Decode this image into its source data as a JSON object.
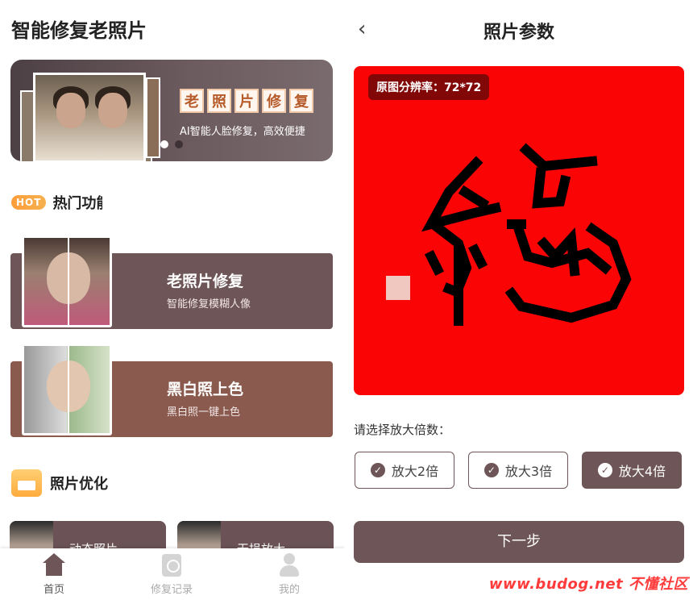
{
  "left": {
    "app_title": "智能修复老照片",
    "banner": {
      "stamp_chars": [
        "老",
        "照",
        "片",
        "修",
        "复"
      ],
      "tagline": "AI智能人脸修复，高效便捷"
    },
    "hot": {
      "badge": "HOT",
      "title": "热门功能"
    },
    "features": [
      {
        "title": "老照片修复",
        "subtitle": "智能修复模糊人像"
      },
      {
        "title": "黑白照上色",
        "subtitle": "黑白照一键上色"
      }
    ],
    "photo_opt": {
      "title": "照片优化",
      "items": [
        "动态照片",
        "无损放大"
      ]
    },
    "tabs": [
      {
        "label": "首页",
        "icon": "home-icon"
      },
      {
        "label": "修复记录",
        "icon": "history-icon"
      },
      {
        "label": "我的",
        "icon": "user-icon"
      }
    ]
  },
  "right": {
    "back_icon": "chevron-left-icon",
    "title": "照片参数",
    "resolution": "原图分辨率：72*72",
    "preview_char": "福",
    "magnify_label": "请选择放大倍数：",
    "options": [
      {
        "label": "放大2倍",
        "selected": false
      },
      {
        "label": "放大3倍",
        "selected": false
      },
      {
        "label": "放大4倍",
        "selected": true
      }
    ],
    "next_label": "下一步",
    "watermark": "www.budog.net 不懂社区"
  },
  "colors": {
    "accent": "#6e5557",
    "card2": "#8a5a4e",
    "preview_bg": "#fb0406"
  }
}
